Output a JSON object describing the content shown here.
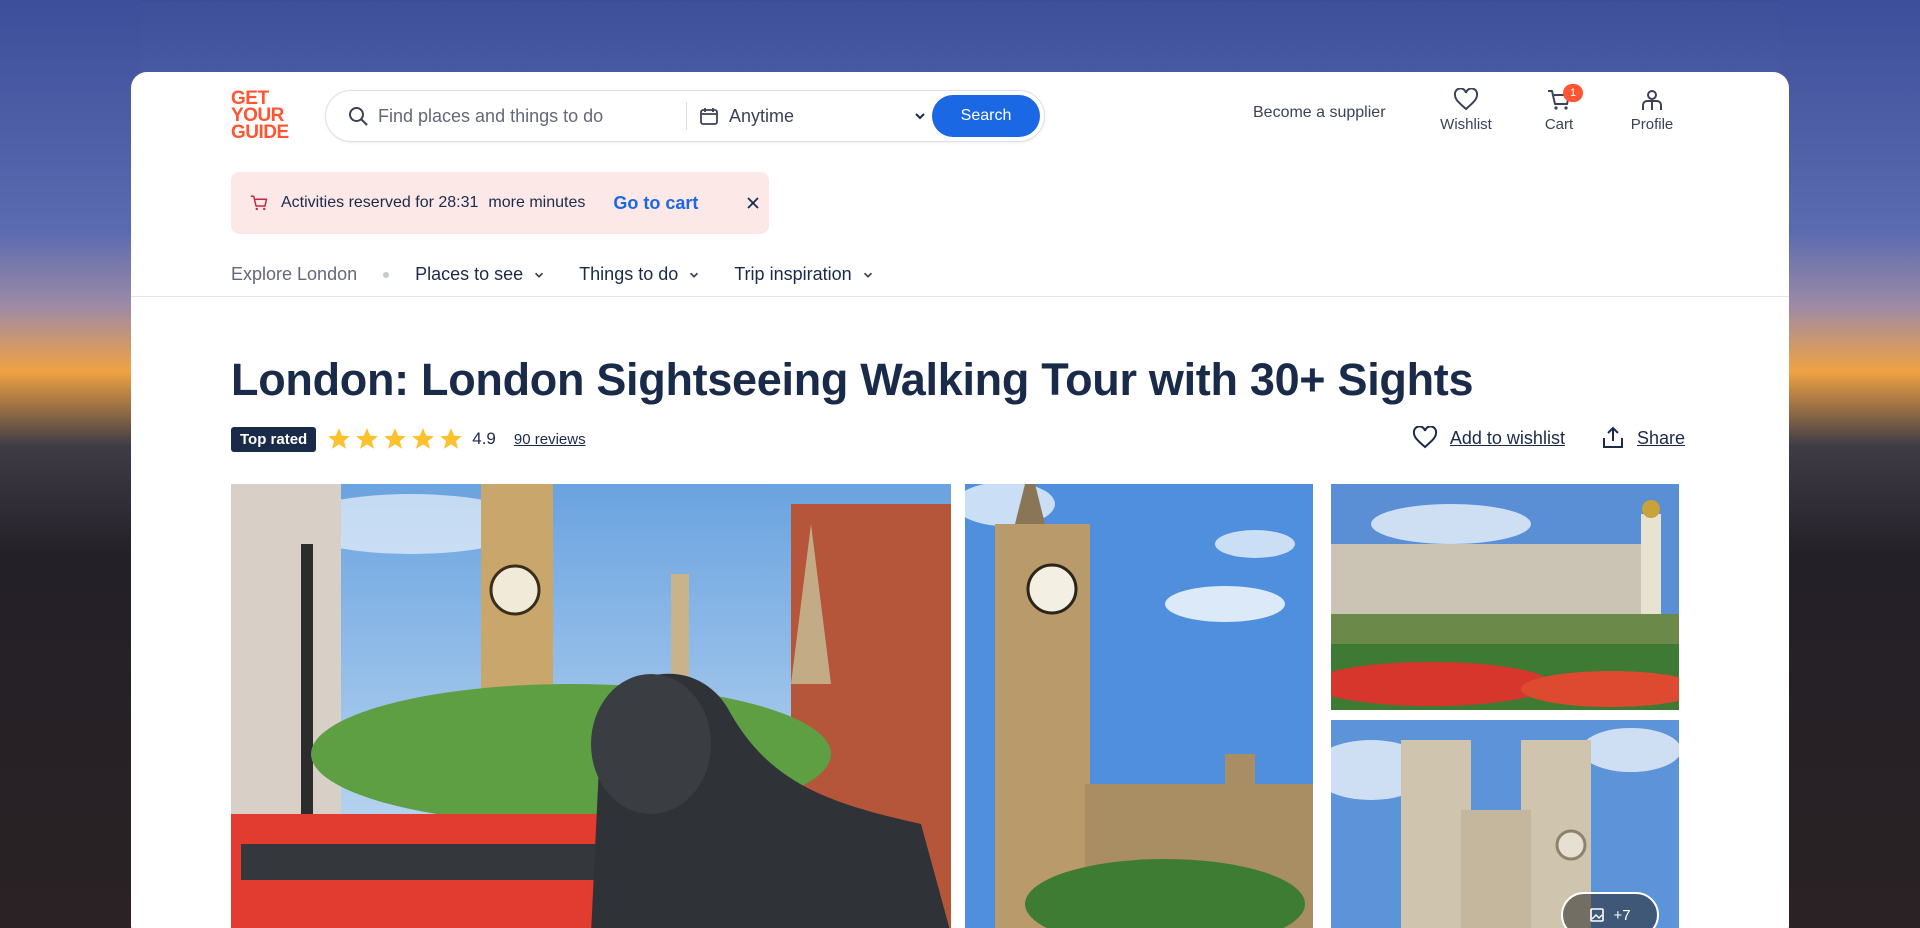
{
  "logo": {
    "line1": "GET",
    "line2": "YOUR",
    "line3": "GUIDE"
  },
  "search": {
    "placeholder": "Find places and things to do",
    "date_value": "Anytime",
    "button_label": "Search"
  },
  "header": {
    "supplier_link": "Become a supplier",
    "wishlist_label": "Wishlist",
    "cart_label": "Cart",
    "cart_count": "1",
    "profile_label": "Profile"
  },
  "alert": {
    "text": "Activities reserved for 28:31",
    "suffix": "more minutes",
    "action": "Go to cart"
  },
  "subnav": {
    "explore": "Explore London",
    "items": [
      {
        "label": "Places to see"
      },
      {
        "label": "Things to do"
      },
      {
        "label": "Trip inspiration"
      }
    ]
  },
  "activity": {
    "title": "London: London Sightseeing Walking Tour with 30+ Sights",
    "badge": "Top rated",
    "rating": "4.9",
    "stars": 5,
    "reviews": "90 reviews",
    "wishlist_action": "Add to wishlist",
    "share_action": "Share"
  },
  "gallery": {
    "more_count": "+7"
  },
  "colors": {
    "brand": "#ff5533",
    "accent": "#1a68e3",
    "navy": "#1a2b49",
    "star": "#fcc12d"
  }
}
